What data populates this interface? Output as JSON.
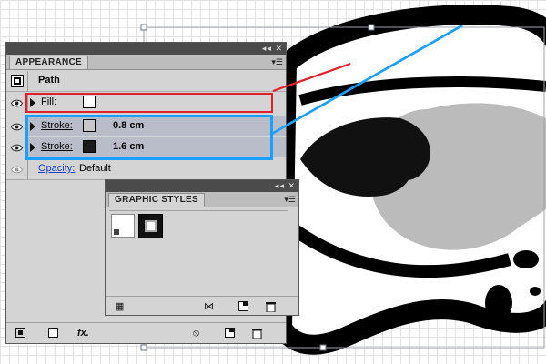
{
  "appearance": {
    "title": "APPEARANCE",
    "path_label": "Path",
    "rows": [
      {
        "label": "Fill:",
        "value": "",
        "swatch": "#ffffff"
      },
      {
        "label": "Stroke:",
        "value": "0.8 cm",
        "swatch": "#c8c8c8"
      },
      {
        "label": "Stroke:",
        "value": "1.6 cm",
        "swatch": "#1a1a1a"
      }
    ],
    "opacity_label": "Opacity:",
    "opacity_value": "Default",
    "fx_label": "fx."
  },
  "graphic_styles": {
    "title": "GRAPHIC STYLES"
  },
  "colors": {
    "fill_highlight": "#e0202a",
    "stroke_highlight": "#1aa0ff",
    "panel_bg": "#d4d4d4",
    "row_selected": "#b9bcc9"
  },
  "icons": {
    "eye": "eye-icon",
    "expand": "triangle-right-icon",
    "collapse": "double-arrow-icon",
    "menu": "panel-menu-icon",
    "delete": "trash-icon",
    "new": "new-item-icon",
    "clear": "clear-appearance-icon",
    "fx": "fx-icon",
    "library": "graphic-style-library-icon",
    "break_link": "break-link-icon"
  }
}
